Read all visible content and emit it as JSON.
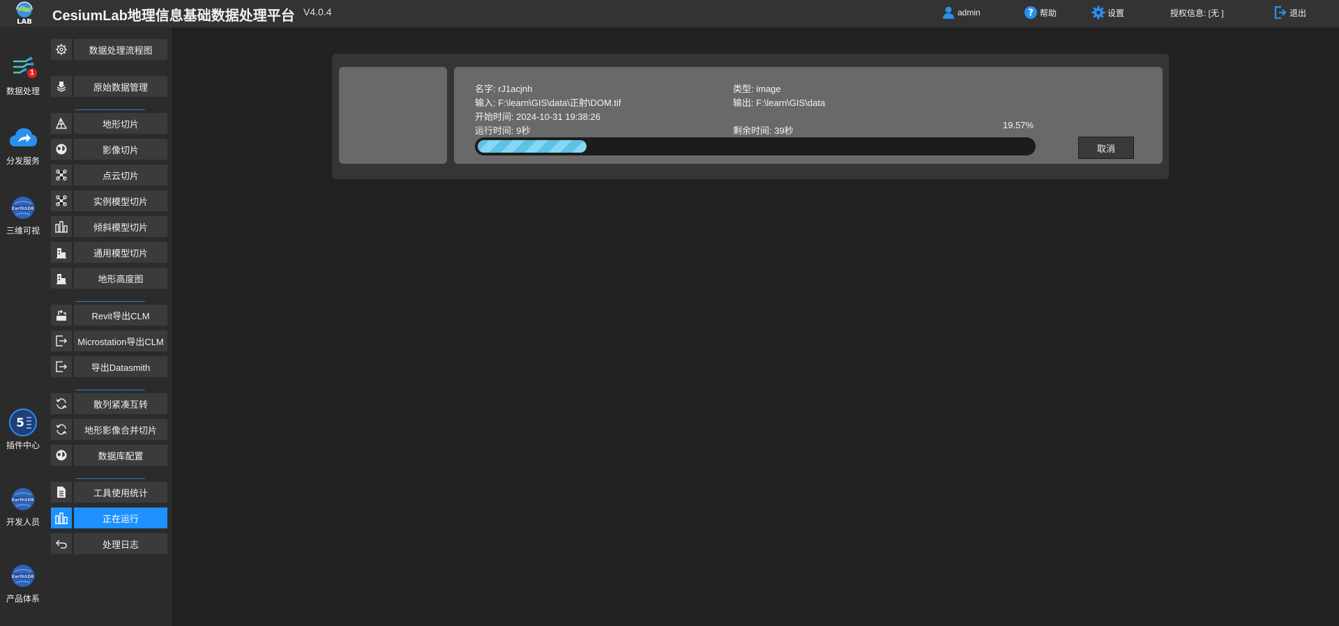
{
  "header": {
    "logo_text": "LAB",
    "title": "CesiumLab地理信息基础数据处理平台",
    "version": "V4.0.4",
    "user": "admin",
    "help": "帮助",
    "settings": "设置",
    "license": "授权信息: [无 ]",
    "logout": "退出",
    "accent_color": "#2b8ff0"
  },
  "rail": {
    "items": [
      {
        "label": "数据处理",
        "icon": "data-process-icon",
        "badge": "1"
      },
      {
        "label": "分发服务",
        "icon": "cloud-share-icon"
      },
      {
        "label": "三维可视",
        "icon": "earthsdk-globe-icon"
      },
      {
        "label": "插件中心",
        "icon": "plugin-center-icon"
      },
      {
        "label": "开发人员",
        "icon": "earthsdk-globe-icon"
      },
      {
        "label": "产品体系",
        "icon": "earthsdk-globe-icon"
      }
    ]
  },
  "menu": {
    "items": [
      {
        "label": "数据处理流程图",
        "icon": "gear-icon"
      },
      {
        "label": "原始数据管理",
        "icon": "database-icon"
      },
      {
        "label": "地形切片",
        "icon": "terrain-icon"
      },
      {
        "label": "影像切片",
        "icon": "globe-icon"
      },
      {
        "label": "点云切片",
        "icon": "point-cloud-icon"
      },
      {
        "label": "实例模型切片",
        "icon": "point-cloud-icon"
      },
      {
        "label": "倾斜模型切片",
        "icon": "buildings-icon"
      },
      {
        "label": "通用模型切片",
        "icon": "building-icon"
      },
      {
        "label": "地形高度图",
        "icon": "building-icon"
      },
      {
        "label": "Revit导出CLM",
        "icon": "export-box-icon"
      },
      {
        "label": "Microstation导出CLM",
        "icon": "export-arrow-icon"
      },
      {
        "label": "导出Datasmith",
        "icon": "export-arrow-icon"
      },
      {
        "label": "散列紧凑互转",
        "icon": "refresh-icon"
      },
      {
        "label": "地形影像合并切片",
        "icon": "refresh-icon"
      },
      {
        "label": "数据库配置",
        "icon": "globe-icon"
      },
      {
        "label": "工具使用统计",
        "icon": "document-icon"
      },
      {
        "label": "正在运行",
        "icon": "buildings-icon",
        "active": true
      },
      {
        "label": "处理日志",
        "icon": "undo-icon"
      }
    ],
    "active_color": "#1e90ff"
  },
  "task": {
    "name": "名字: rJ1acjnh",
    "type": "类型: image",
    "input": "输入: F:\\learn\\GIS\\data\\正射\\DOM.tif",
    "output": "输出: F:\\learn\\GIS\\data",
    "start_time": "开始时间: 2024-10-31 19:38:26",
    "run_time": "运行时间: 9秒",
    "remaining": "剩余时间: 39秒",
    "progress_text": "19.57%",
    "progress": 0.1957,
    "cancel": "取消"
  }
}
